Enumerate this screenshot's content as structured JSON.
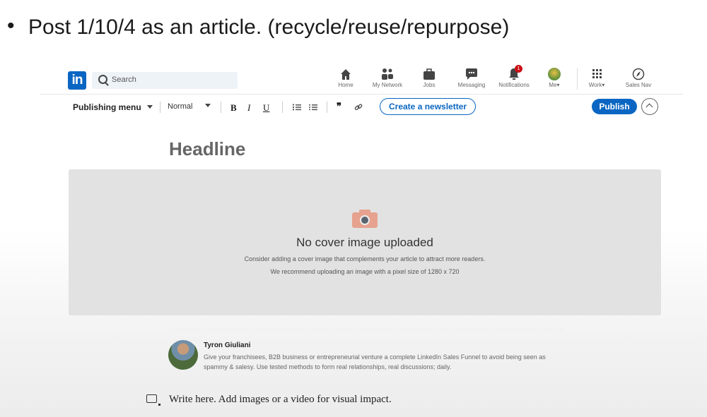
{
  "slide": {
    "bullet": "•",
    "text": "Post 1/10/4 as an article.  (recycle/reuse/repurpose)"
  },
  "nav": {
    "logo_text": "in",
    "search_placeholder": "Search",
    "items": [
      {
        "label": "Home",
        "icon": "home-icon"
      },
      {
        "label": "My Network",
        "icon": "network-icon"
      },
      {
        "label": "Jobs",
        "icon": "briefcase-icon"
      },
      {
        "label": "Messaging",
        "icon": "message-icon"
      },
      {
        "label": "Notifications",
        "icon": "bell-icon",
        "badge": "1"
      },
      {
        "label": "Me",
        "icon": "avatar-icon"
      },
      {
        "label": "Work",
        "icon": "grid-icon"
      },
      {
        "label": "Sales Nav",
        "icon": "compass-icon"
      }
    ]
  },
  "toolbar": {
    "publishing_menu": "Publishing menu",
    "style_select": "Normal",
    "bold": "B",
    "italic": "I",
    "underline": "U",
    "quote": "❞",
    "newsletter_button": "Create a newsletter",
    "publish_button": "Publish"
  },
  "editor": {
    "headline_placeholder": "Headline",
    "cover": {
      "title": "No cover image uploaded",
      "line1": "Consider adding a cover image that complements your article to attract more readers.",
      "line2": "We recommend uploading an image with a pixel size of 1280 x 720"
    },
    "author": {
      "name": "Tyron Giuliani",
      "bio": "Give your franchisees, B2B business or entrepreneurial venture a complete LinkedIn Sales Funnel to avoid being seen as spammy & salesy. Use tested methods to form real relationships, real discussions; daily."
    },
    "body_placeholder": "Write here. Add images or a video for visual impact."
  },
  "colors": {
    "linkedin_blue": "#0a66c2",
    "notification_red": "#cc1016"
  }
}
